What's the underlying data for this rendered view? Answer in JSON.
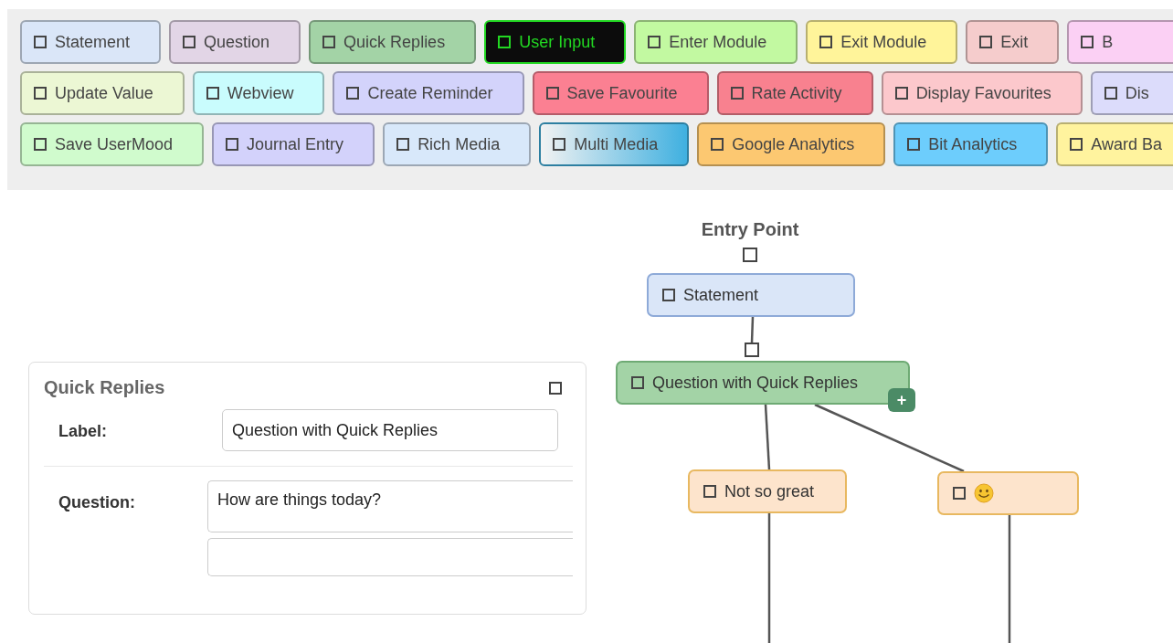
{
  "palette": {
    "rows": [
      {
        "items": [
          {
            "label": "Statement",
            "kind": "plain",
            "color": "#dae6f8"
          },
          {
            "label": "Question",
            "kind": "plain",
            "color": "#e2d5e6"
          },
          {
            "label": "Quick Replies",
            "kind": "plain",
            "color": "#a3d3a6"
          },
          {
            "label": "User Input",
            "kind": "dark",
            "color": "#0c0c0c"
          },
          {
            "label": "Enter Module",
            "kind": "plain",
            "color": "#c2f9a1"
          },
          {
            "label": "Exit Module",
            "kind": "plain",
            "color": "#fff49a"
          },
          {
            "label": "Exit",
            "kind": "plain",
            "color": "#f5cccc"
          },
          {
            "label": "B",
            "kind": "plain",
            "color": "#fbd0f4"
          }
        ]
      },
      {
        "items": [
          {
            "label": "Update Value",
            "kind": "plain",
            "color": "#ecf7d4"
          },
          {
            "label": "Webview",
            "kind": "plain",
            "color": "#c9fcfd"
          },
          {
            "label": "Create Reminder",
            "kind": "plain",
            "color": "#d3d3fb"
          },
          {
            "label": "Save Favourite",
            "kind": "plain",
            "color": "#fb8092"
          },
          {
            "label": "Rate Activity",
            "kind": "plain",
            "color": "#f8818f"
          },
          {
            "label": "Display Favourites",
            "kind": "plain",
            "color": "#fcc8cc"
          },
          {
            "label": "Dis",
            "kind": "plain",
            "color": "#dcdcfb"
          }
        ]
      },
      {
        "items": [
          {
            "label": "Save UserMood",
            "kind": "plain",
            "color": "#d0fbcd"
          },
          {
            "label": "Journal Entry",
            "kind": "plain",
            "color": "#d3d2fb"
          },
          {
            "label": "Rich Media",
            "kind": "plain",
            "color": "#d8e8fa"
          },
          {
            "label": "Multi Media",
            "kind": "gradient",
            "color": "#3fb0e0"
          },
          {
            "label": "Google Analytics",
            "kind": "plain",
            "color": "#fcc871"
          },
          {
            "label": "Bit Analytics",
            "kind": "plain",
            "color": "#6dcdfc"
          },
          {
            "label": "Award Ba",
            "kind": "plain",
            "color": "#fff39e"
          }
        ]
      }
    ]
  },
  "canvas": {
    "entry_point": {
      "label": "Entry Point"
    },
    "nodes": [
      {
        "label": "Statement",
        "kind": "statement"
      },
      {
        "label": "Question with Quick Replies",
        "kind": "question",
        "add_label": "+"
      },
      {
        "label": "Not so great",
        "kind": "answer"
      },
      {
        "kind": "emoji_answer"
      }
    ]
  },
  "panel": {
    "title": "Quick Replies",
    "fields": [
      {
        "label": "Label:",
        "kind": "input",
        "value": "Question with Quick Replies"
      },
      {
        "label": "Question:",
        "kind": "textarea",
        "value": "How are things today?"
      }
    ]
  }
}
